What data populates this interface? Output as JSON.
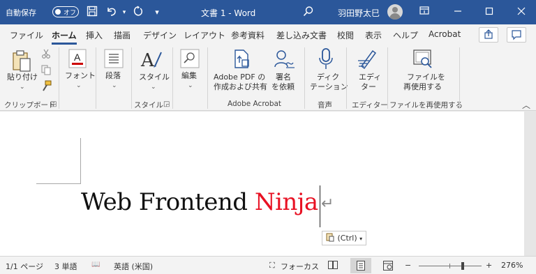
{
  "titlebar": {
    "autosave_label": "自動保存",
    "autosave_state": "オフ",
    "doc_title": "文書 1  -  Word",
    "user_name": "羽田野太巳",
    "icons": [
      "save-icon",
      "undo-icon",
      "redo-icon",
      "customize-qat-icon",
      "search-icon",
      "ribbon-display-icon",
      "minimize-icon",
      "maximize-icon",
      "close-icon"
    ]
  },
  "tabs": [
    {
      "label": "ファイル"
    },
    {
      "label": "ホーム",
      "active": true
    },
    {
      "label": "挿入"
    },
    {
      "label": "描画"
    },
    {
      "label": "デザイン"
    },
    {
      "label": "レイアウト"
    },
    {
      "label": "参考資料"
    },
    {
      "label": "差し込み文書"
    },
    {
      "label": "校閲"
    },
    {
      "label": "表示"
    },
    {
      "label": "ヘルプ"
    },
    {
      "label": "Acrobat"
    }
  ],
  "ribbon": {
    "paste": "貼り付け",
    "font": "フォント",
    "paragraph": "段落",
    "style": "スタイル",
    "edit": "編集",
    "adobe_pdf_1": "Adobe PDF の",
    "adobe_pdf_2": "作成および共有",
    "sign_1": "署名",
    "sign_2": "を依頼",
    "dictation_1": "ディク",
    "dictation_2": "テーション",
    "editor_1": "エディ",
    "editor_2": "ター",
    "reuse_1": "ファイルを",
    "reuse_2": "再使用する",
    "groups": {
      "clipboard": "クリップボード",
      "style": "スタイル",
      "acrobat": "Adobe Acrobat",
      "voice": "音声",
      "editor": "エディター",
      "reuse": "ファイルを再使用する"
    }
  },
  "document": {
    "text_black": "Web Frontend ",
    "text_red": "Ninja",
    "paste_options": "(Ctrl)",
    "accent_red": "#e81123"
  },
  "status": {
    "page": "1/1 ページ",
    "words": "3 単語",
    "language": "英語 (米国)",
    "focus": "フォーカス",
    "zoom": "276%",
    "zoom_minus": "−",
    "zoom_plus": "+"
  },
  "colors": {
    "titlebar": "#2b579a",
    "ribbon": "#f3f3f3"
  }
}
